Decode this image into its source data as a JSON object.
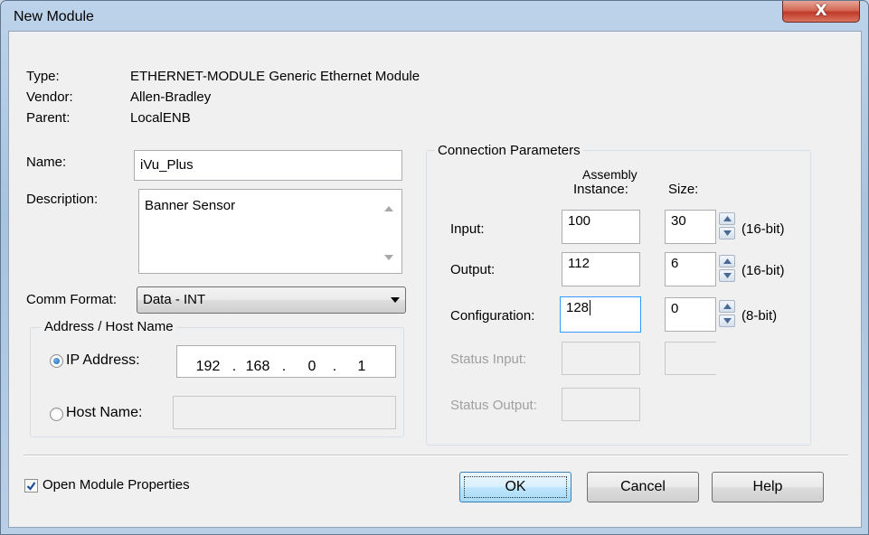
{
  "window": {
    "title": "New Module",
    "close_label": "X"
  },
  "info": {
    "type_label": "Type:",
    "type_value": "ETHERNET-MODULE Generic Ethernet Module",
    "vendor_label": "Vendor:",
    "vendor_value": "Allen-Bradley",
    "parent_label": "Parent:",
    "parent_value": "LocalENB",
    "name_label": "Name:",
    "name_value": "iVu_Plus",
    "description_label": "Description:",
    "description_value": "Banner Sensor",
    "comm_format_label": "Comm Format:",
    "comm_format_value": "Data - INT"
  },
  "address": {
    "group_label": "Address / Host Name",
    "ip_label": "IP Address:",
    "ip_octets": [
      "192",
      "168",
      "0",
      "1"
    ],
    "dot": ".",
    "host_label": "Host Name:",
    "host_value": "",
    "selected": "ip"
  },
  "connection": {
    "group_label": "Connection Parameters",
    "col_assembly_line1": "Assembly",
    "col_assembly_line2": "Instance:",
    "col_size": "Size:",
    "rows": [
      {
        "label": "Input:",
        "instance": "100",
        "size": "30",
        "unit": "(16-bit)",
        "enabled": true
      },
      {
        "label": "Output:",
        "instance": "112",
        "size": "6",
        "unit": "(16-bit)",
        "enabled": true
      },
      {
        "label": "Configuration:",
        "instance": "128",
        "size": "0",
        "unit": "(8-bit)",
        "enabled": true
      },
      {
        "label": "Status Input:",
        "instance": "",
        "size": "",
        "unit": "",
        "enabled": false
      },
      {
        "label": "Status Output:",
        "instance": "",
        "size": "",
        "unit": "",
        "enabled": false
      }
    ]
  },
  "footer": {
    "open_props_label": "Open Module Properties",
    "open_props_checked": true,
    "ok_label": "OK",
    "cancel_label": "Cancel",
    "help_label": "Help"
  },
  "colors": {
    "title_bar": "#b4cce6",
    "close_button": "#c0392b",
    "default_button": "#3c7fb1",
    "dialog_bg": "#f0f0f0"
  }
}
